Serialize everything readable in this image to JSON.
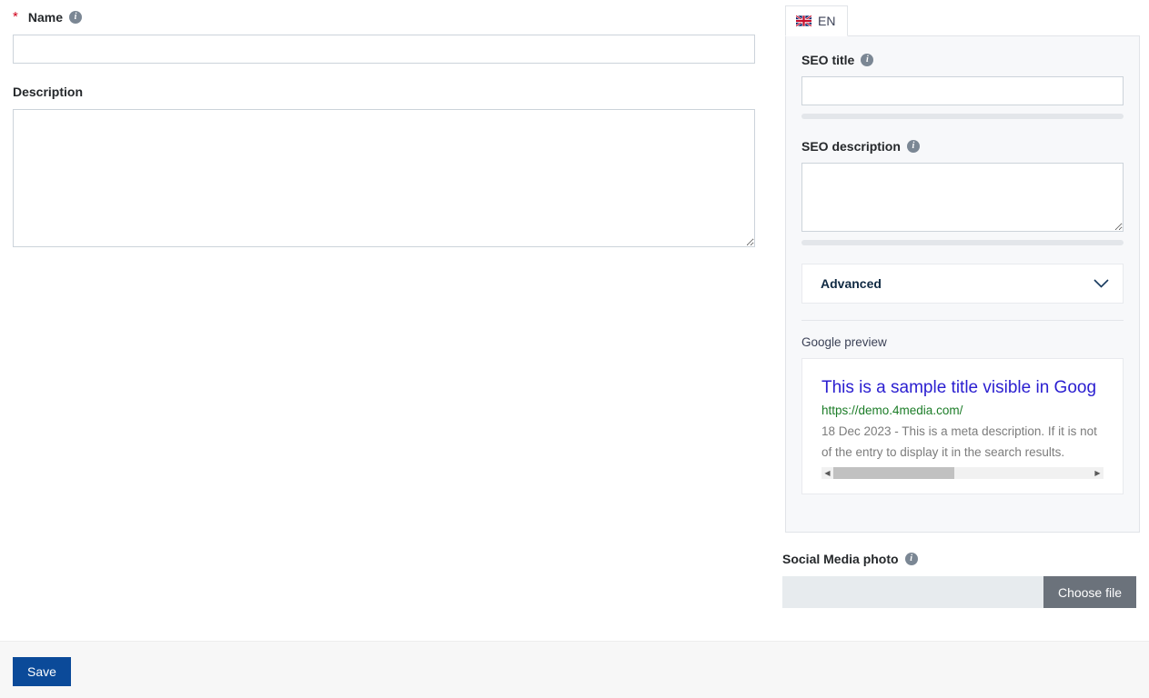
{
  "form": {
    "name": {
      "label": "Name",
      "required_marker": "*",
      "info_icon": "info-icon",
      "value": "",
      "placeholder": ""
    },
    "description": {
      "label": "Description",
      "value": "",
      "placeholder": ""
    }
  },
  "seo_panel": {
    "tab": {
      "label": "EN",
      "flag_icon": "uk-flag-icon"
    },
    "seo_title": {
      "label": "SEO title",
      "info_icon": "info-icon",
      "value": "",
      "placeholder": "",
      "meter_percent": 0
    },
    "seo_description": {
      "label": "SEO description",
      "info_icon": "info-icon",
      "value": "",
      "placeholder": "",
      "meter_percent": 0
    },
    "advanced": {
      "label": "Advanced",
      "chevron_icon": "chevron-down-icon",
      "expanded": false
    },
    "google_preview": {
      "label": "Google preview",
      "title": "This is a sample title visible in Goog",
      "url": "https://demo.4media.com/",
      "description": "18 Dec 2023 - This is a meta description. If it is not",
      "description_line2": "of the entry to display it in the search results.",
      "scroll_left_icon": "scroll-left-arrow-icon",
      "scroll_right_icon": "scroll-right-arrow-icon",
      "scroll_thumb_percent": 47
    }
  },
  "social_media_photo": {
    "label": "Social Media photo",
    "info_icon": "info-icon",
    "file_value": "",
    "choose_file_label": "Choose file"
  },
  "footer": {
    "save_label": "Save"
  },
  "colors": {
    "accent_blue": "#0b4a99",
    "required_red": "#d0021b",
    "panel_bg": "#f7f8fa",
    "google_title": "#2a1ed0",
    "google_url": "#1b7c27",
    "file_button": "#6b727b"
  }
}
